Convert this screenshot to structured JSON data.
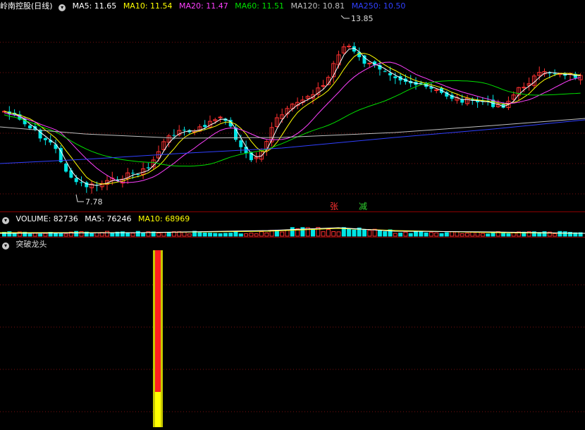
{
  "price_panel": {
    "title": "岭南控股(日线)",
    "ma_legend": [
      {
        "label": "MA5: 11.65",
        "color": "#ffffff"
      },
      {
        "label": "MA10: 11.54",
        "color": "#ffff00"
      },
      {
        "label": "MA20: 11.47",
        "color": "#ff40ff"
      },
      {
        "label": "MA60: 11.51",
        "color": "#00e000"
      },
      {
        "label": "MA120: 10.81",
        "color": "#c0c0c0"
      },
      {
        "label": "MA250: 10.50",
        "color": "#3040ff"
      }
    ],
    "high_label": "13.85",
    "low_label": "7.78",
    "markers": [
      {
        "text": "张",
        "color": "#ff3030"
      },
      {
        "text": "减",
        "color": "#30d030"
      }
    ],
    "up_color": "#ff3030",
    "down_color": "#00e5e5"
  },
  "volume_panel": {
    "legend": [
      {
        "label": "VOLUME: 82736",
        "color": "#ffffff"
      },
      {
        "label": "MA5: 76246",
        "color": "#ffffff"
      },
      {
        "label": "MA10: 68969",
        "color": "#ffff00"
      }
    ]
  },
  "indicator_panel": {
    "title": "突破龙头",
    "bar_colors": {
      "top": "#ff2020",
      "bottom": "#ffff00",
      "edge": "#c8c800"
    }
  },
  "icons": {
    "collapse": "chevron-down-icon"
  }
}
